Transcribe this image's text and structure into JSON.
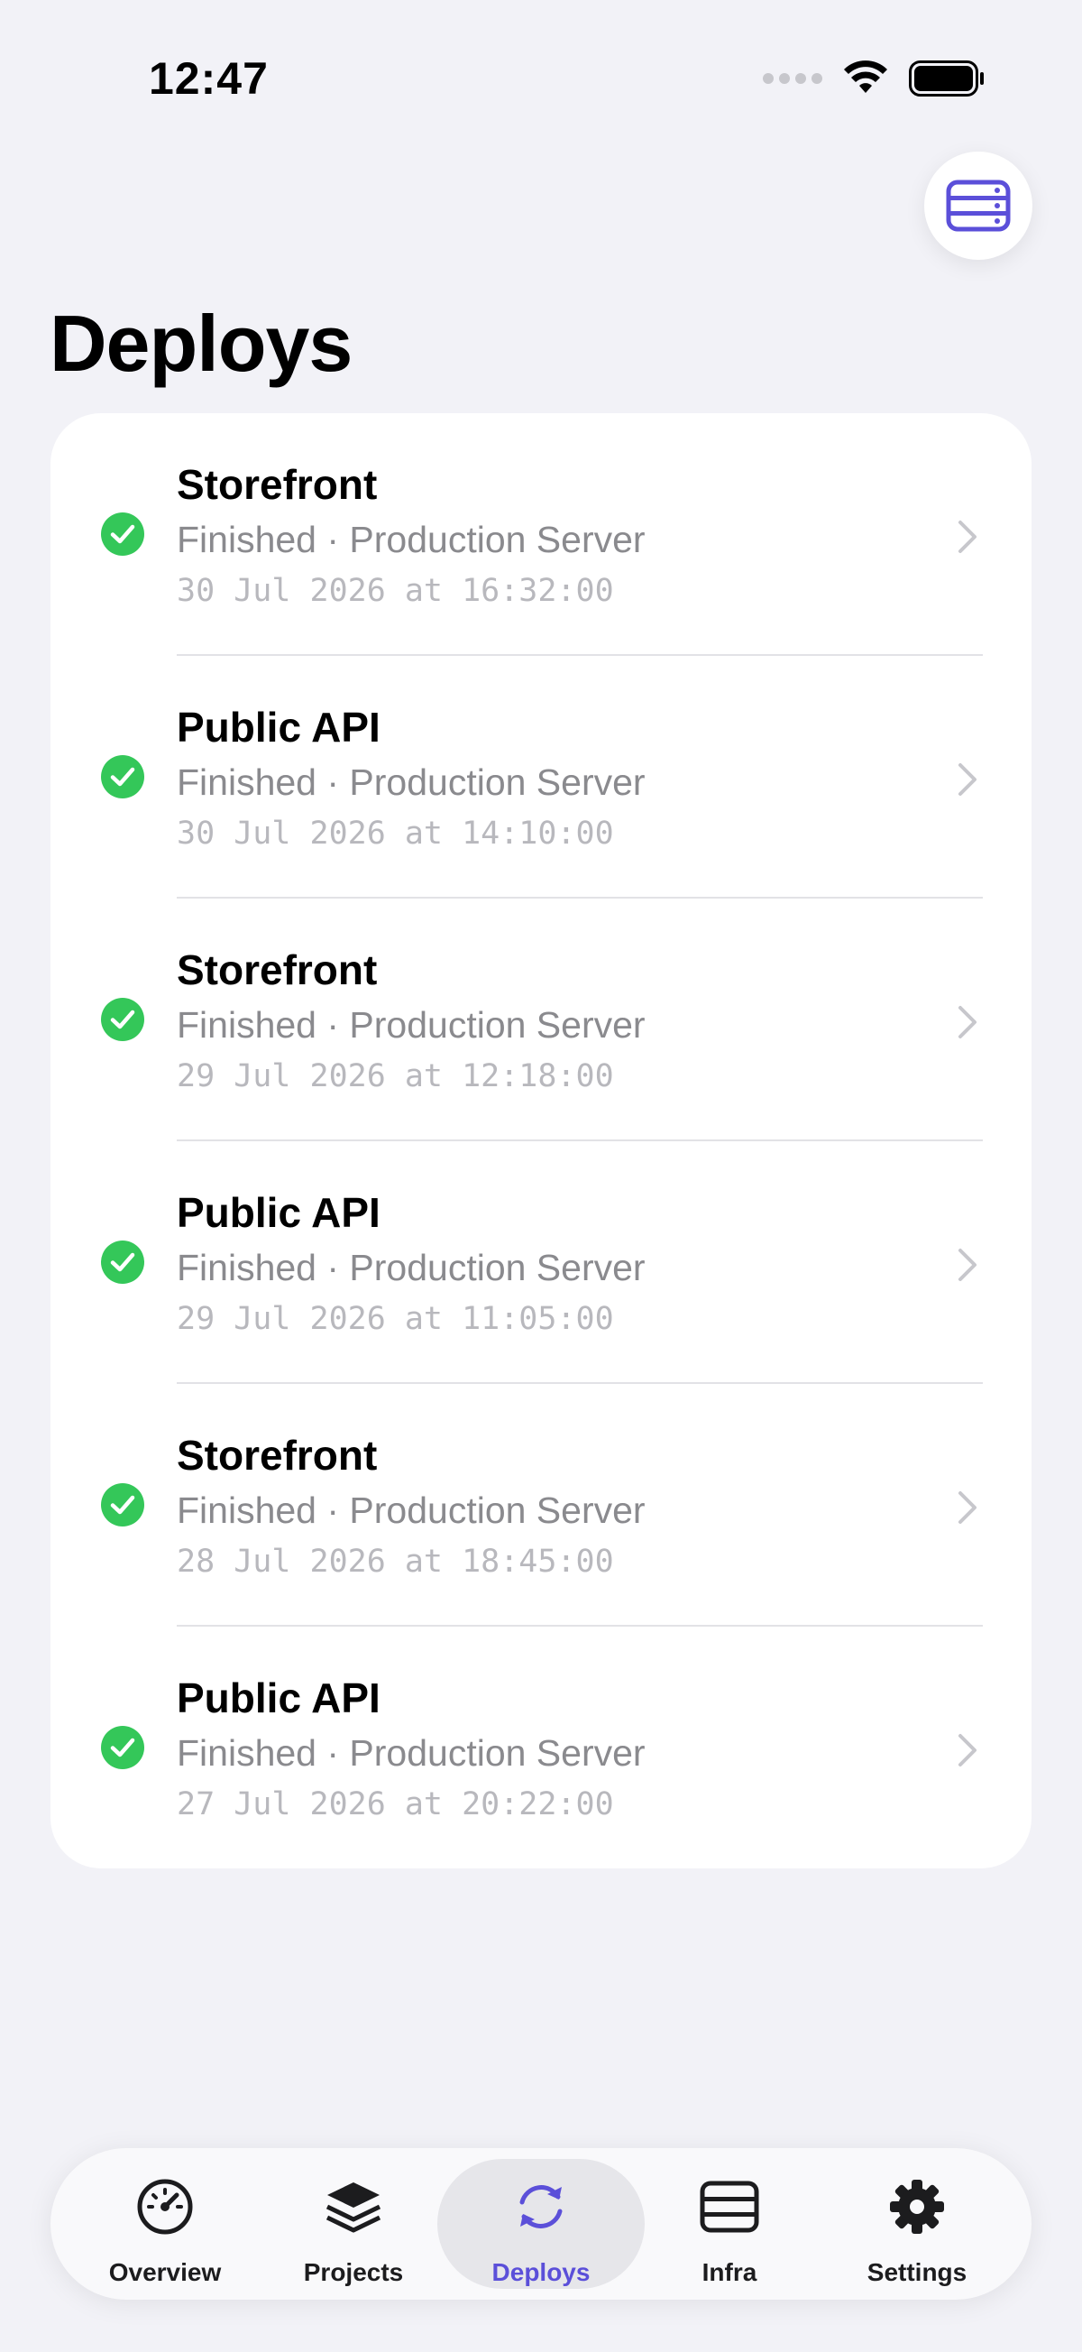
{
  "status_bar": {
    "time": "12:47"
  },
  "page": {
    "title": "Deploys"
  },
  "colors": {
    "accent": "#5b4fd9",
    "success": "#34c759",
    "background": "#f2f2f7"
  },
  "deploys": [
    {
      "project": "Storefront",
      "status": "Finished · Production Server",
      "timestamp": "30 Jul 2026 at 16:32:00",
      "icon": "check-circle-icon"
    },
    {
      "project": "Public API",
      "status": "Finished · Production Server",
      "timestamp": "30 Jul 2026 at 14:10:00",
      "icon": "check-circle-icon"
    },
    {
      "project": "Storefront",
      "status": "Finished · Production Server",
      "timestamp": "29 Jul 2026 at 12:18:00",
      "icon": "check-circle-icon"
    },
    {
      "project": "Public API",
      "status": "Finished · Production Server",
      "timestamp": "29 Jul 2026 at 11:05:00",
      "icon": "check-circle-icon"
    },
    {
      "project": "Storefront",
      "status": "Finished · Production Server",
      "timestamp": "28 Jul 2026 at 18:45:00",
      "icon": "check-circle-icon"
    },
    {
      "project": "Public API",
      "status": "Finished · Production Server",
      "timestamp": "27 Jul 2026 at 20:22:00",
      "icon": "check-circle-icon"
    }
  ],
  "tab_bar": {
    "active": "Deploys",
    "tabs": [
      {
        "label": "Overview",
        "icon": "gauge-icon"
      },
      {
        "label": "Projects",
        "icon": "stack-icon"
      },
      {
        "label": "Deploys",
        "icon": "sync-arrows-icon"
      },
      {
        "label": "Infra",
        "icon": "server-rack-icon"
      },
      {
        "label": "Settings",
        "icon": "gear-icon"
      }
    ]
  }
}
